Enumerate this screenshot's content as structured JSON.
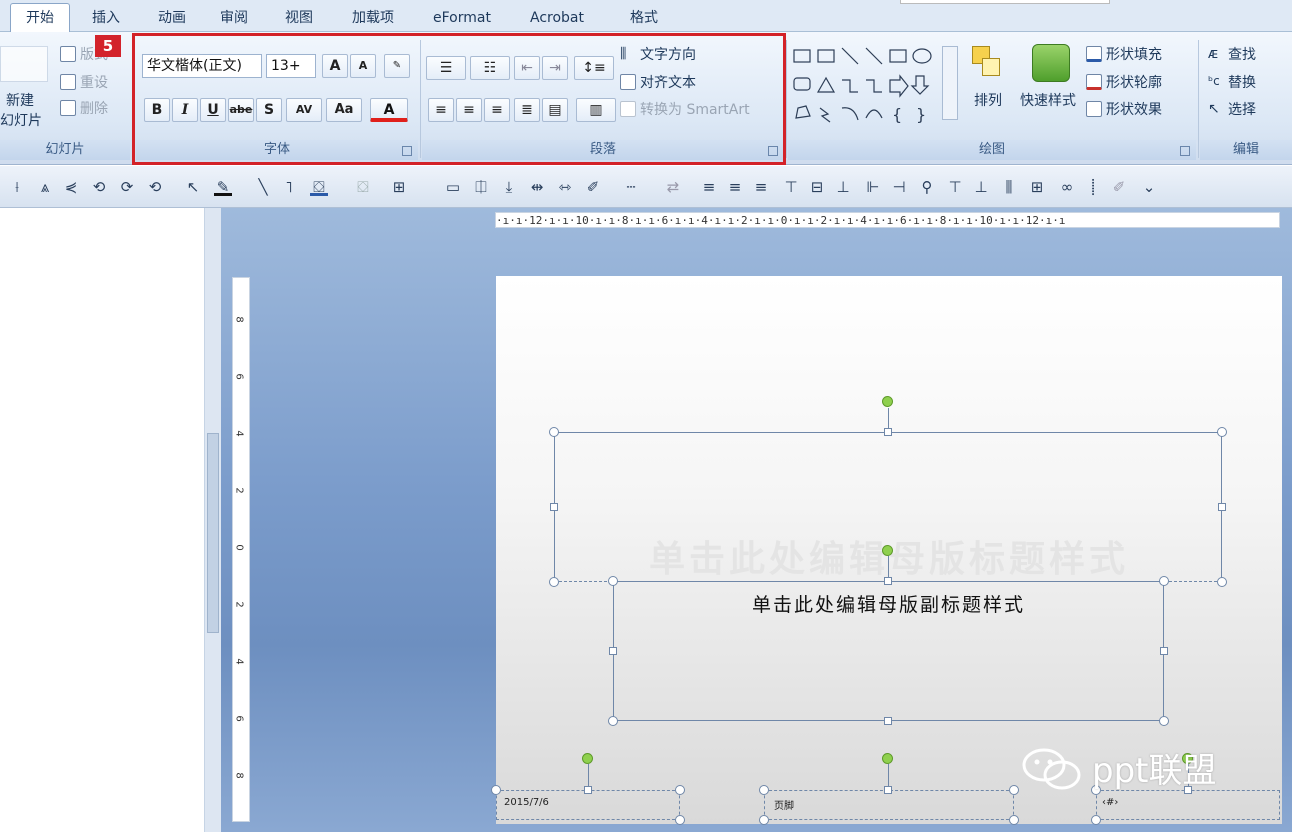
{
  "tabs": [
    "开始",
    "插入",
    "动画",
    "审阅",
    "视图",
    "加载项",
    "eFormat",
    "Acrobat",
    "格式"
  ],
  "badge": "5",
  "slides_group": {
    "new_slide_1": "新建",
    "new_slide_2": "幻灯片",
    "layout": "版式",
    "reset": "重设",
    "delete": "删除",
    "label": "幻灯片"
  },
  "font_group": {
    "font_name": "华文楷体(正文)",
    "font_size": "13+",
    "label": "字体",
    "bold": "B",
    "italic": "I",
    "underline": "U",
    "strike": "abe",
    "shadow": "S",
    "spacing": "AV",
    "case": "Aa",
    "color": "A",
    "grow": "A",
    "shrink": "A"
  },
  "para_group": {
    "text_direction": "文字方向",
    "align_text": "对齐文本",
    "smartart": "转换为 SmartArt",
    "label": "段落"
  },
  "draw_group": {
    "arrange": "排列",
    "quick_styles": "快速样式",
    "fill": "形状填充",
    "outline": "形状轮廓",
    "effects": "形状效果",
    "label": "绘图"
  },
  "edit_group": {
    "find": "查找",
    "replace": "替换",
    "select": "选择",
    "label": "编辑"
  },
  "hruler_text": "·ı·ı·12·ı·ı·10·ı·ı·8·ı·ı·6·ı·ı·4·ı·ı·2·ı·ı·0·ı·ı·2·ı·ı·4·ı·ı·6·ı·ı·8·ı·ı·10·ı·ı·12·ı·ı",
  "vruler_labels": [
    "8",
    "6",
    "4",
    "2",
    "0",
    "2",
    "4",
    "6",
    "8"
  ],
  "slide": {
    "title_placeholder": "单击此处编辑母版标题样式",
    "subtitle_placeholder": "单击此处编辑母版副标题样式",
    "date": "2015/7/6",
    "footer": "页脚",
    "number": "‹#›"
  },
  "watermark": "ppt联盟",
  "colors": {
    "highlight_box": "#d32228",
    "ribbon": "#dbe7f5",
    "workspace": "#7b9ccb",
    "rotate_handle": "#8fd04e"
  }
}
